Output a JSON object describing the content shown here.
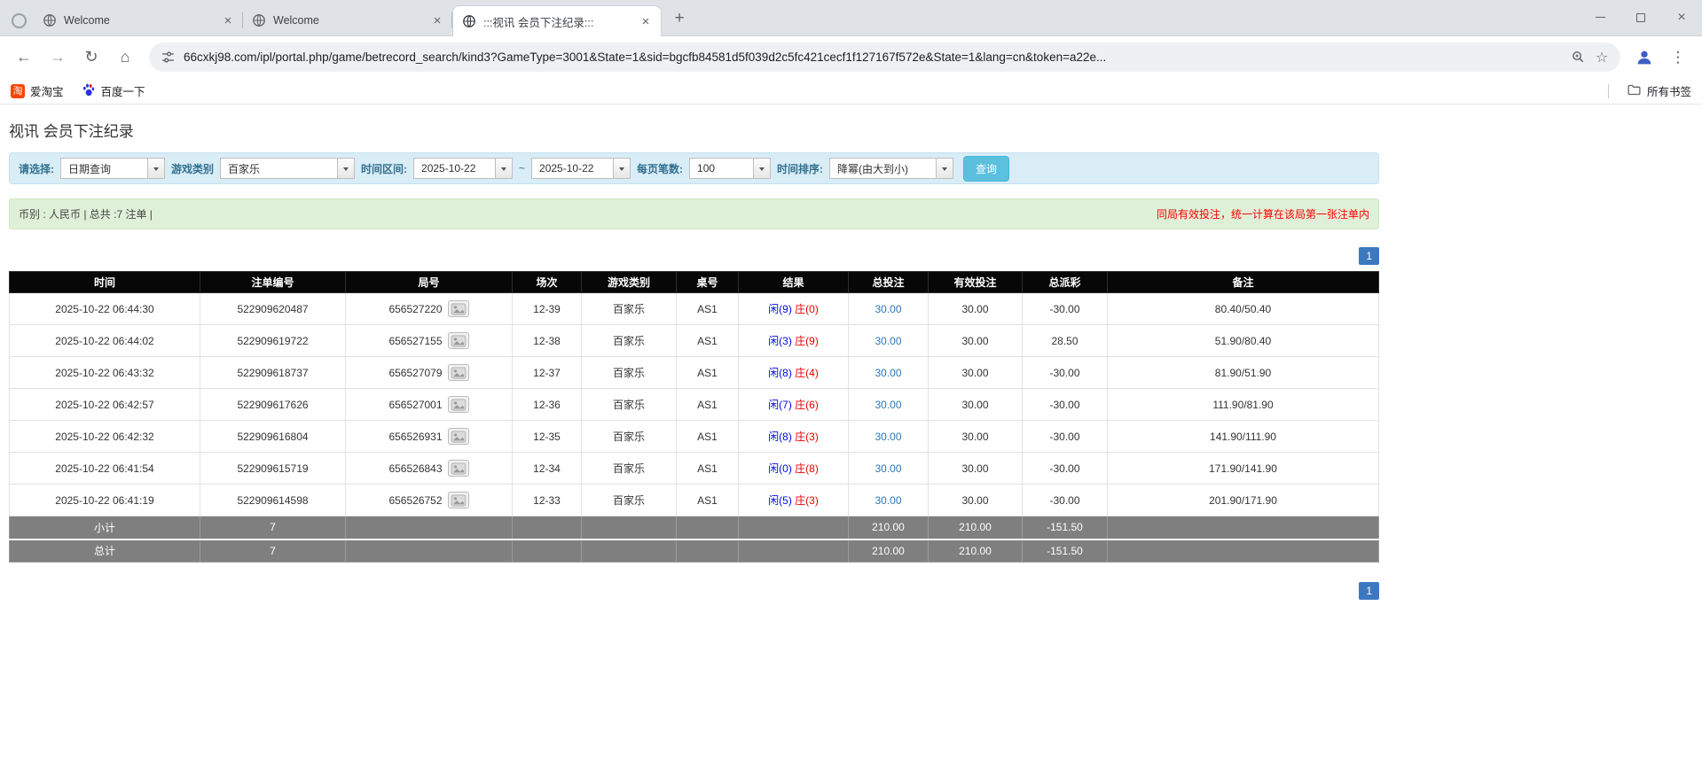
{
  "browser": {
    "tabs": [
      {
        "title": "Welcome"
      },
      {
        "title": "Welcome"
      },
      {
        "title": ":::视讯 会员下注纪录:::"
      }
    ],
    "url": "66cxkj98.com/ipl/portal.php/game/betrecord_search/kind3?GameType=3001&State=1&sid=bgcfb84581d5f039d2c5fc421cecf1f127167f572e&State=1&lang=cn&token=a22e...",
    "bookmarks": {
      "taobao": "爱淘宝",
      "taobao_icon_char": "淘",
      "baidu": "百度一下",
      "all_bookmarks": "所有书签"
    },
    "icons": {
      "back": "←",
      "forward": "→",
      "reload": "↻",
      "home": "⌂",
      "menu": "⋮",
      "star": "☆",
      "close": "×",
      "new_tab": "+"
    }
  },
  "colors": {
    "accent_blue": "#3c78c0",
    "player_blue": "#0009e8",
    "banker_red": "#e80000",
    "negative_red": "#e60000",
    "header_bg": "#070707",
    "summary_gray": "#7f7f7f",
    "filter_bg": "#d9edf7",
    "info_bg": "#dff0d8",
    "search_btn": "#5bc0de"
  },
  "page": {
    "title": "视讯 会员下注纪录",
    "filter": {
      "select_label": "请选择:",
      "select_value": "日期查询",
      "game_label": "游戏类别",
      "game_value": "百家乐",
      "range_label": "时间区间:",
      "date_from": "2025-10-22",
      "date_to": "2025-10-22",
      "tilde": "~",
      "per_page_label": "每页笔数:",
      "per_page_value": "100",
      "sort_label": "时间排序:",
      "sort_value": "降幂(由大到小)",
      "search_button": "查询"
    },
    "summary_bar": {
      "left": "币别 : 人民币 | 总共 :7 注单 |",
      "right": "同局有效投注，统一计算在该局第一张注单内"
    },
    "pagination": {
      "page": "1"
    },
    "table": {
      "headers": [
        "时间",
        "注单编号",
        "局号",
        "场次",
        "游戏类别",
        "桌号",
        "结果",
        "总投注",
        "有效投注",
        "总派彩",
        "备注"
      ],
      "rows": [
        {
          "time": "2025-10-22 06:44:30",
          "bet_no": "522909620487",
          "round_no": "656527220",
          "session": "12-39",
          "game": "百家乐",
          "table_no": "AS1",
          "result_player": "闲(9)",
          "result_banker": "庄(0)",
          "total_bet": "30.00",
          "valid_bet": "30.00",
          "payout": "-30.00",
          "note": "80.40/50.40"
        },
        {
          "time": "2025-10-22 06:44:02",
          "bet_no": "522909619722",
          "round_no": "656527155",
          "session": "12-38",
          "game": "百家乐",
          "table_no": "AS1",
          "result_player": "闲(3)",
          "result_banker": "庄(9)",
          "total_bet": "30.00",
          "valid_bet": "30.00",
          "payout": "28.50",
          "note": "51.90/80.40"
        },
        {
          "time": "2025-10-22 06:43:32",
          "bet_no": "522909618737",
          "round_no": "656527079",
          "session": "12-37",
          "game": "百家乐",
          "table_no": "AS1",
          "result_player": "闲(8)",
          "result_banker": "庄(4)",
          "total_bet": "30.00",
          "valid_bet": "30.00",
          "payout": "-30.00",
          "note": "81.90/51.90"
        },
        {
          "time": "2025-10-22 06:42:57",
          "bet_no": "522909617626",
          "round_no": "656527001",
          "session": "12-36",
          "game": "百家乐",
          "table_no": "AS1",
          "result_player": "闲(7)",
          "result_banker": "庄(6)",
          "total_bet": "30.00",
          "valid_bet": "30.00",
          "payout": "-30.00",
          "note": "111.90/81.90"
        },
        {
          "time": "2025-10-22 06:42:32",
          "bet_no": "522909616804",
          "round_no": "656526931",
          "session": "12-35",
          "game": "百家乐",
          "table_no": "AS1",
          "result_player": "闲(8)",
          "result_banker": "庄(3)",
          "total_bet": "30.00",
          "valid_bet": "30.00",
          "payout": "-30.00",
          "note": "141.90/111.90"
        },
        {
          "time": "2025-10-22 06:41:54",
          "bet_no": "522909615719",
          "round_no": "656526843",
          "session": "12-34",
          "game": "百家乐",
          "table_no": "AS1",
          "result_player": "闲(0)",
          "result_banker": "庄(8)",
          "total_bet": "30.00",
          "valid_bet": "30.00",
          "payout": "-30.00",
          "note": "171.90/141.90"
        },
        {
          "time": "2025-10-22 06:41:19",
          "bet_no": "522909614598",
          "round_no": "656526752",
          "session": "12-33",
          "game": "百家乐",
          "table_no": "AS1",
          "result_player": "闲(5)",
          "result_banker": "庄(3)",
          "total_bet": "30.00",
          "valid_bet": "30.00",
          "payout": "-30.00",
          "note": "201.90/171.90"
        }
      ],
      "subtotal": {
        "label": "小计",
        "count": "7",
        "total_bet": "210.00",
        "valid_bet": "210.00",
        "payout": "-151.50"
      },
      "grand_total": {
        "label": "总计",
        "count": "7",
        "total_bet": "210.00",
        "valid_bet": "210.00",
        "payout": "-151.50"
      }
    }
  }
}
